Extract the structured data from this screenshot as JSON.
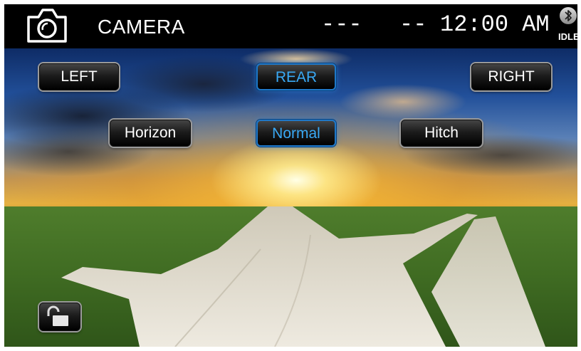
{
  "header": {
    "title": "CAMERA",
    "status_left": "---",
    "status_right": "--",
    "clock": "12:00 AM",
    "bluetooth_status": "IDLE"
  },
  "buttons": {
    "left": "LEFT",
    "rear": "REAR",
    "right": "RIGHT",
    "horizon": "Horizon",
    "normal": "Normal",
    "hitch": "Hitch"
  },
  "active_color": "#39a9f5",
  "icons": [
    "camera-icon",
    "bluetooth-icon",
    "lock-open-icon"
  ]
}
